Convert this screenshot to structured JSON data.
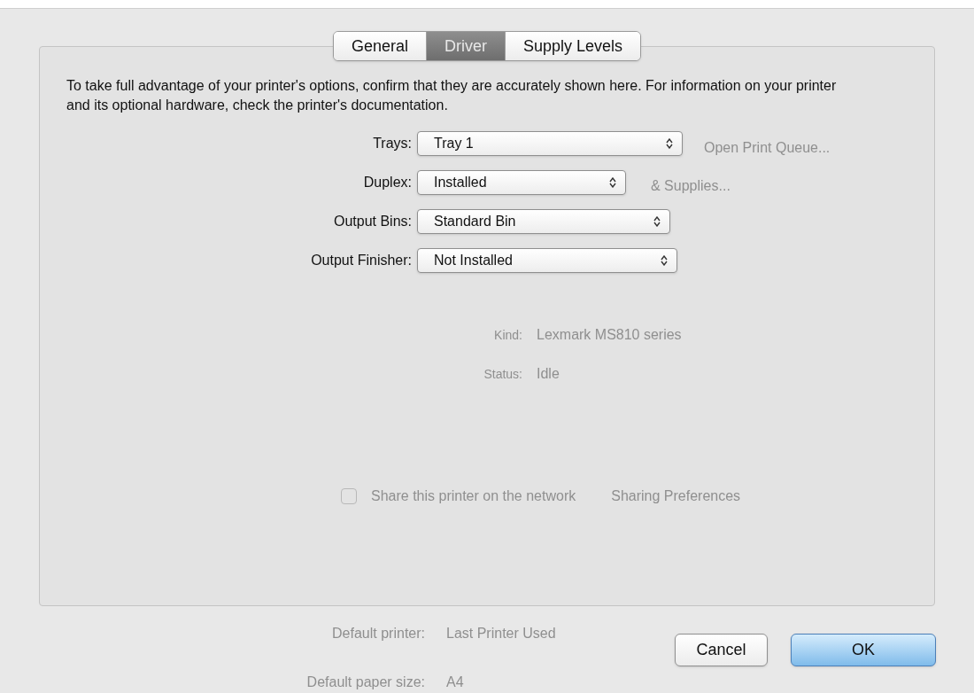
{
  "tabs": [
    {
      "label": "General",
      "selected": false
    },
    {
      "label": "Driver",
      "selected": true
    },
    {
      "label": "Supply Levels",
      "selected": false
    }
  ],
  "description": "To take full advantage of your printer's options, confirm that they are accurately shown here. For information on your printer and its optional hardware, check the printer's documentation.",
  "settings": [
    {
      "label": "Trays:",
      "value": "Tray 1"
    },
    {
      "label": "Duplex:",
      "value": "Installed"
    },
    {
      "label": "Output Bins:",
      "value": "Standard Bin"
    },
    {
      "label": "Output Finisher:",
      "value": "Not Installed"
    }
  ],
  "buttons": [
    {
      "label": "Cancel",
      "default": false
    },
    {
      "label": "OK",
      "default": true
    }
  ],
  "background": {
    "buttons": [
      "Open Print Queue...",
      "& Supplies..."
    ],
    "info": [
      {
        "label": "Kind:",
        "value": "Lexmark MS810 series"
      },
      {
        "label": "Status:",
        "value": "Idle"
      }
    ],
    "share": {
      "label": "Share this printer on the network",
      "checked": false,
      "button": "Sharing Preferences"
    },
    "defaults": [
      {
        "label": "Default printer:",
        "value": "Last Printer Used"
      },
      {
        "label": "Default paper size:",
        "value": "A4"
      }
    ]
  }
}
